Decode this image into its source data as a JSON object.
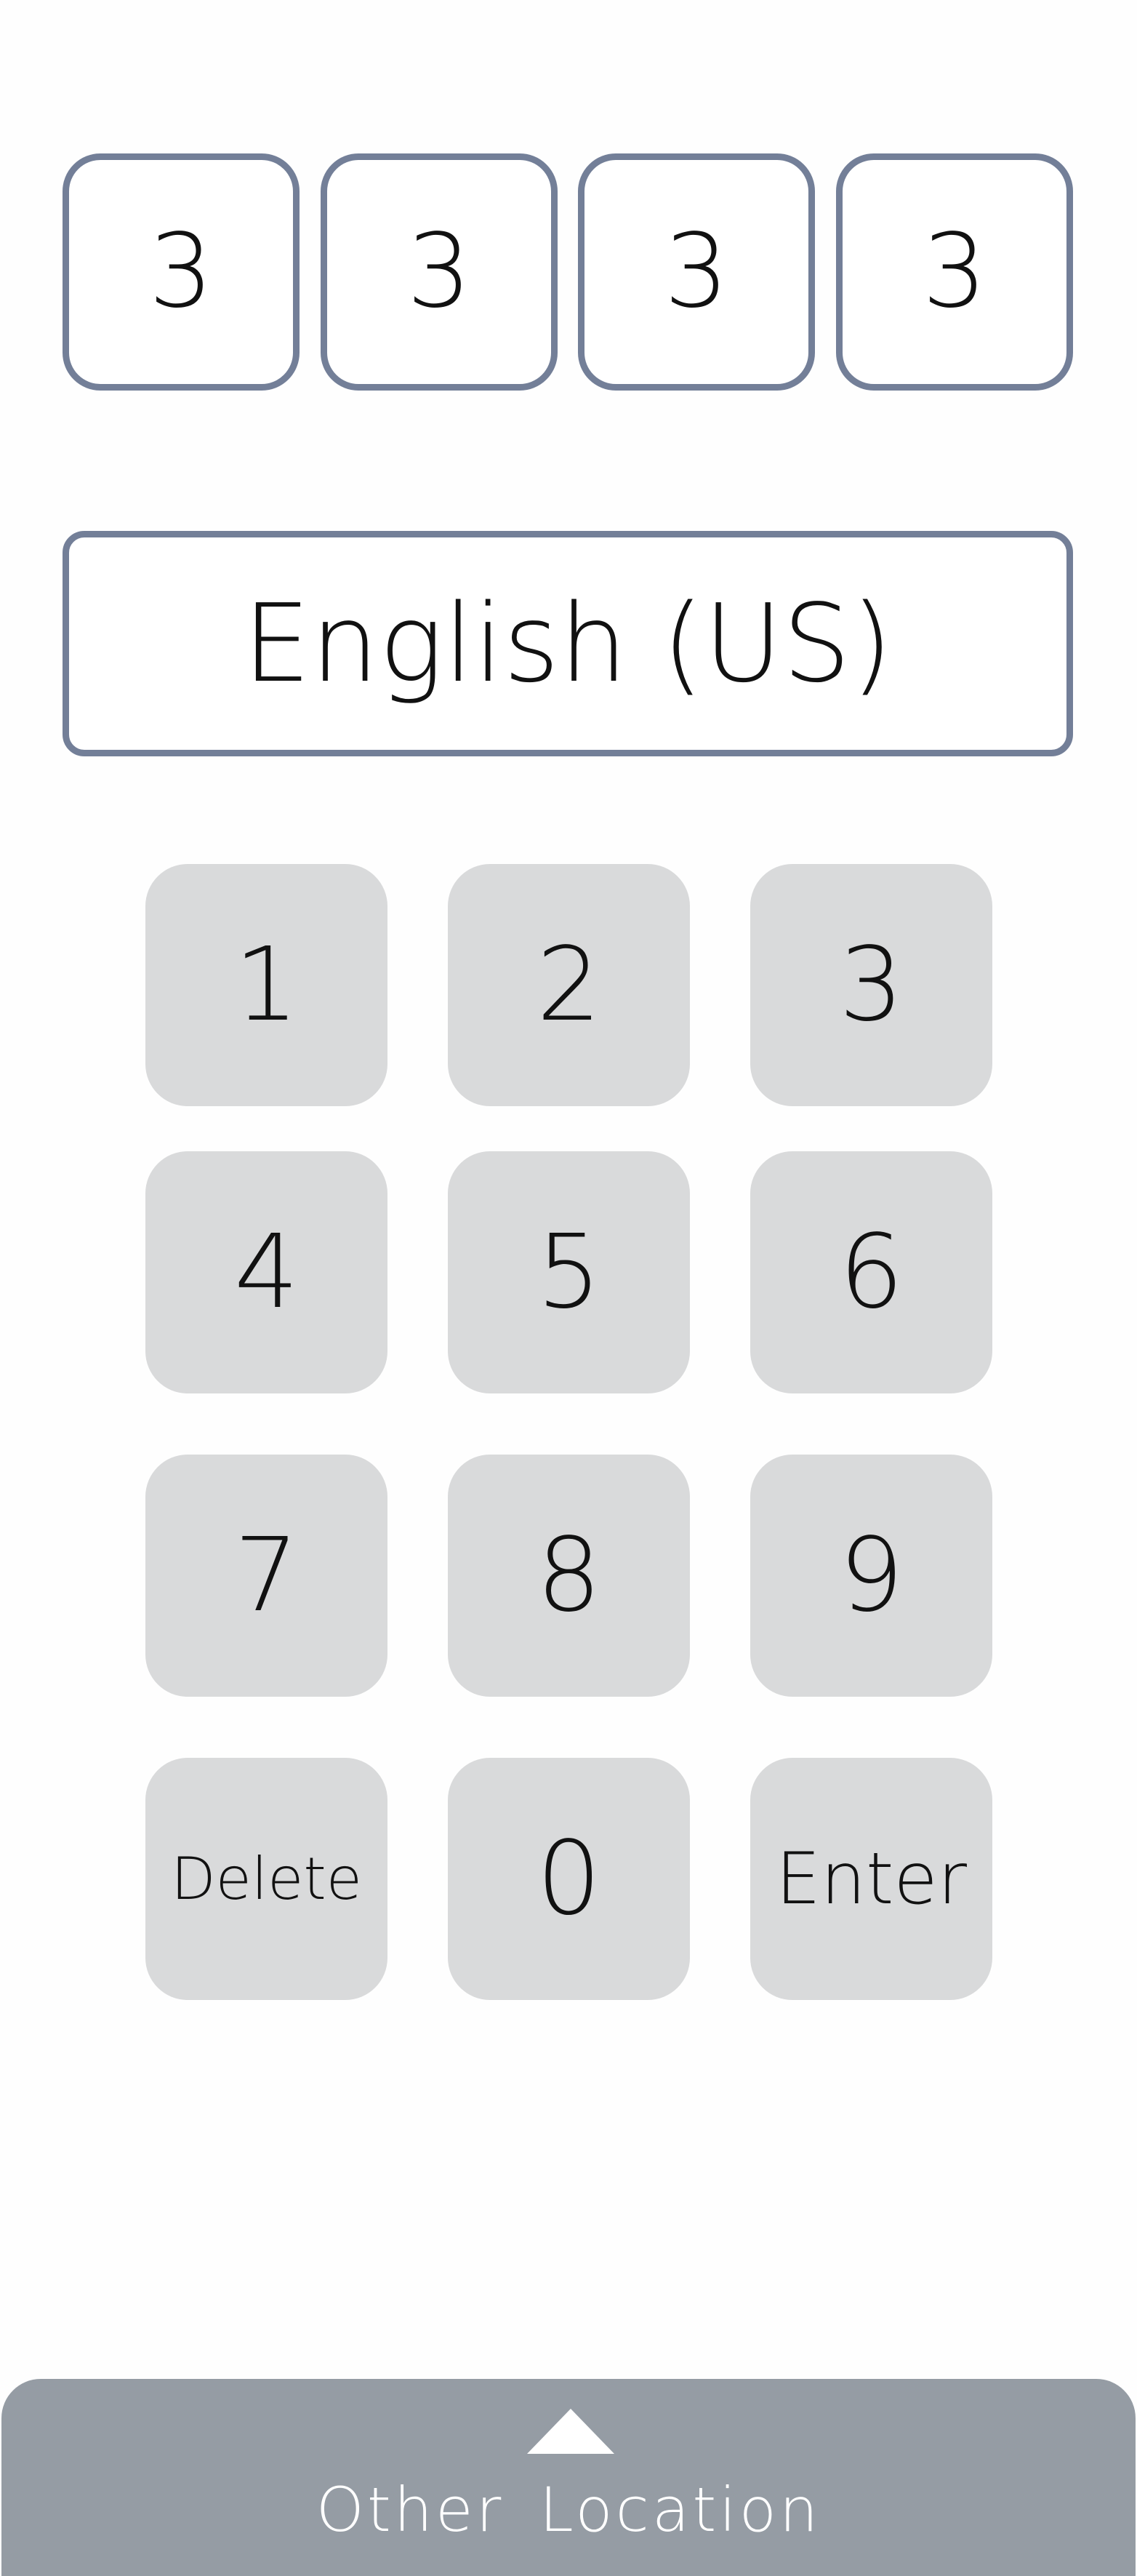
{
  "pin_entry": {
    "digits": [
      "3",
      "3",
      "3",
      "3"
    ]
  },
  "language_selector": {
    "value": "English (US)"
  },
  "keypad": {
    "keys": {
      "k1": "1",
      "k2": "2",
      "k3": "3",
      "k4": "4",
      "k5": "5",
      "k6": "6",
      "k7": "7",
      "k8": "8",
      "k9": "9",
      "delete": "Delete",
      "k0": "0",
      "enter": "Enter"
    }
  },
  "bottom_drawer": {
    "label": "Other  Location",
    "icon": "triangle-up-icon"
  },
  "colors": {
    "background": "#fefefe",
    "box_border": "#737f98",
    "key_fill": "#d9dadb",
    "drawer_fill": "#959ca4",
    "text": "#111111",
    "drawer_text": "#ffffff"
  }
}
